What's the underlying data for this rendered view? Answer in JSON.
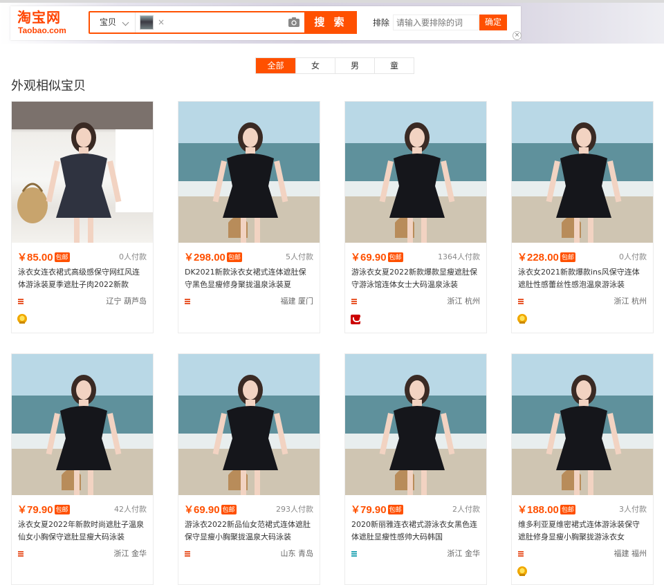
{
  "header": {
    "logo_cn": "淘宝网",
    "logo_en": "Taobao.com",
    "scope_label": "宝贝",
    "thumb_close": "×",
    "search_button": "搜 索",
    "exclude_label": "排除",
    "exclude_placeholder": "请输入要排除的词",
    "confirm_button": "确定",
    "panel_close": "×"
  },
  "tabs": [
    {
      "label": "全部",
      "active": true
    },
    {
      "label": "女",
      "active": false
    },
    {
      "label": "男",
      "active": false
    },
    {
      "label": "童",
      "active": false
    }
  ],
  "section_title": "外观相似宝贝",
  "products": [
    {
      "price": "85.00",
      "badge": "包邮",
      "sales": "0人付款",
      "title": "泳衣女连衣裙式高级感保守网红风连体游泳装夏季遮肚子肉2022新款",
      "location": "辽宁 葫芦岛",
      "extra": "crown",
      "image": "room",
      "store_color": "#e8562a"
    },
    {
      "price": "298.00",
      "badge": "包邮",
      "sales": "5人付款",
      "title": "DK2021新款泳衣女裙式连体遮肚保守黑色显瘦修身聚拢温泉泳装夏",
      "location": "福建 厦门",
      "extra": "",
      "image": "beach",
      "store_color": "#e8562a"
    },
    {
      "price": "69.90",
      "badge": "包邮",
      "sales": "1364人付款",
      "title": "游泳衣女夏2022新款爆款显瘦遮肚保守游泳馆连体女士大码温泉泳装",
      "location": "浙江 杭州",
      "extra": "tmall",
      "image": "beach",
      "store_color": "#e8562a"
    },
    {
      "price": "228.00",
      "badge": "包邮",
      "sales": "0人付款",
      "title": "泳衣女2021新款爆款ins风保守连体遮肚性感蕾丝性感泡温泉游泳装",
      "location": "浙江 杭州",
      "extra": "crown",
      "image": "beach",
      "store_color": "#e8562a"
    },
    {
      "price": "79.90",
      "badge": "包邮",
      "sales": "42人付款",
      "title": "泳衣女夏2022年新款时尚遮肚子温泉仙女小胸保守遮肚显瘦大码泳装",
      "location": "浙江 金华",
      "extra": "",
      "image": "beach",
      "store_color": "#e8562a"
    },
    {
      "price": "69.90",
      "badge": "包邮",
      "sales": "293人付款",
      "title": "游泳衣2022新品仙女范裙式连体遮肚保守显瘦小胸聚拢温泉大码泳装",
      "location": "山东 青岛",
      "extra": "",
      "image": "beach",
      "store_color": "#e8562a"
    },
    {
      "price": "79.90",
      "badge": "包邮",
      "sales": "2人付款",
      "title": "2020新丽雅连衣裙式游泳衣女黑色连体遮肚显瘦性感帅大码韩国",
      "location": "浙江 金华",
      "extra": "",
      "image": "beach",
      "store_color": "#2aa6b5"
    },
    {
      "price": "188.00",
      "badge": "包邮",
      "sales": "3人付款",
      "title": "维多利亚夏维密裙式连体游泳装保守遮肚修身显瘦小胸聚拢游泳衣女",
      "location": "福建 福州",
      "extra": "crown",
      "image": "beach",
      "store_color": "#e8562a"
    }
  ],
  "currency": "￥"
}
